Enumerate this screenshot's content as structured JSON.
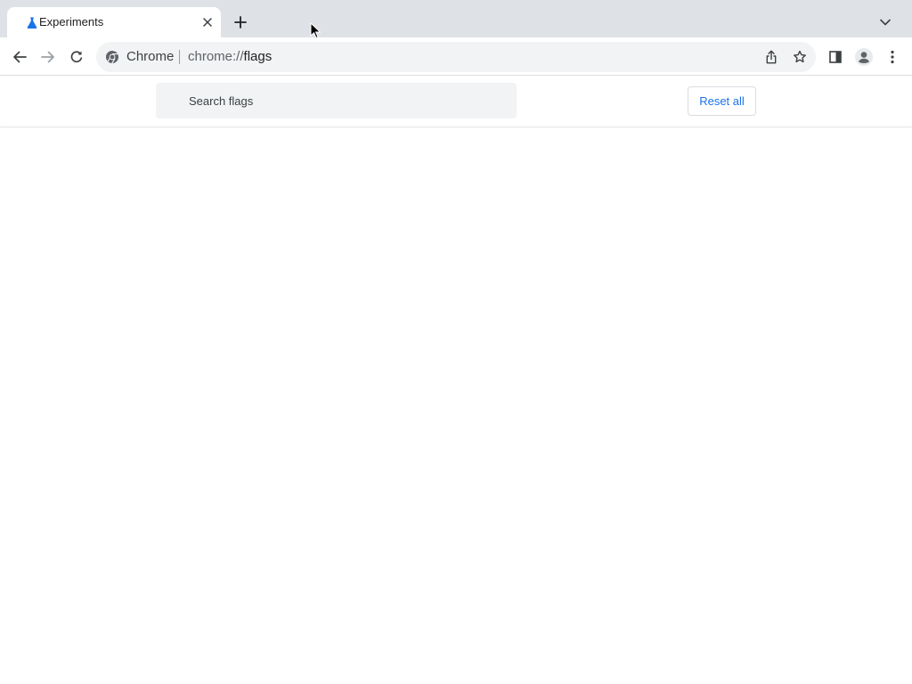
{
  "browser": {
    "tab": {
      "title": "Experiments",
      "favicon": "flask-icon"
    },
    "omnibox": {
      "chip_label": "Chrome",
      "url_scheme": "chrome://",
      "url_host": "flags"
    }
  },
  "flags_page": {
    "search": {
      "placeholder": "Search flags",
      "value": ""
    },
    "reset_all_label": "Reset all"
  },
  "colors": {
    "tabstrip_bg": "#dee1e6",
    "accent": "#1a73e8",
    "omnibox_bg": "#f1f3f4"
  }
}
